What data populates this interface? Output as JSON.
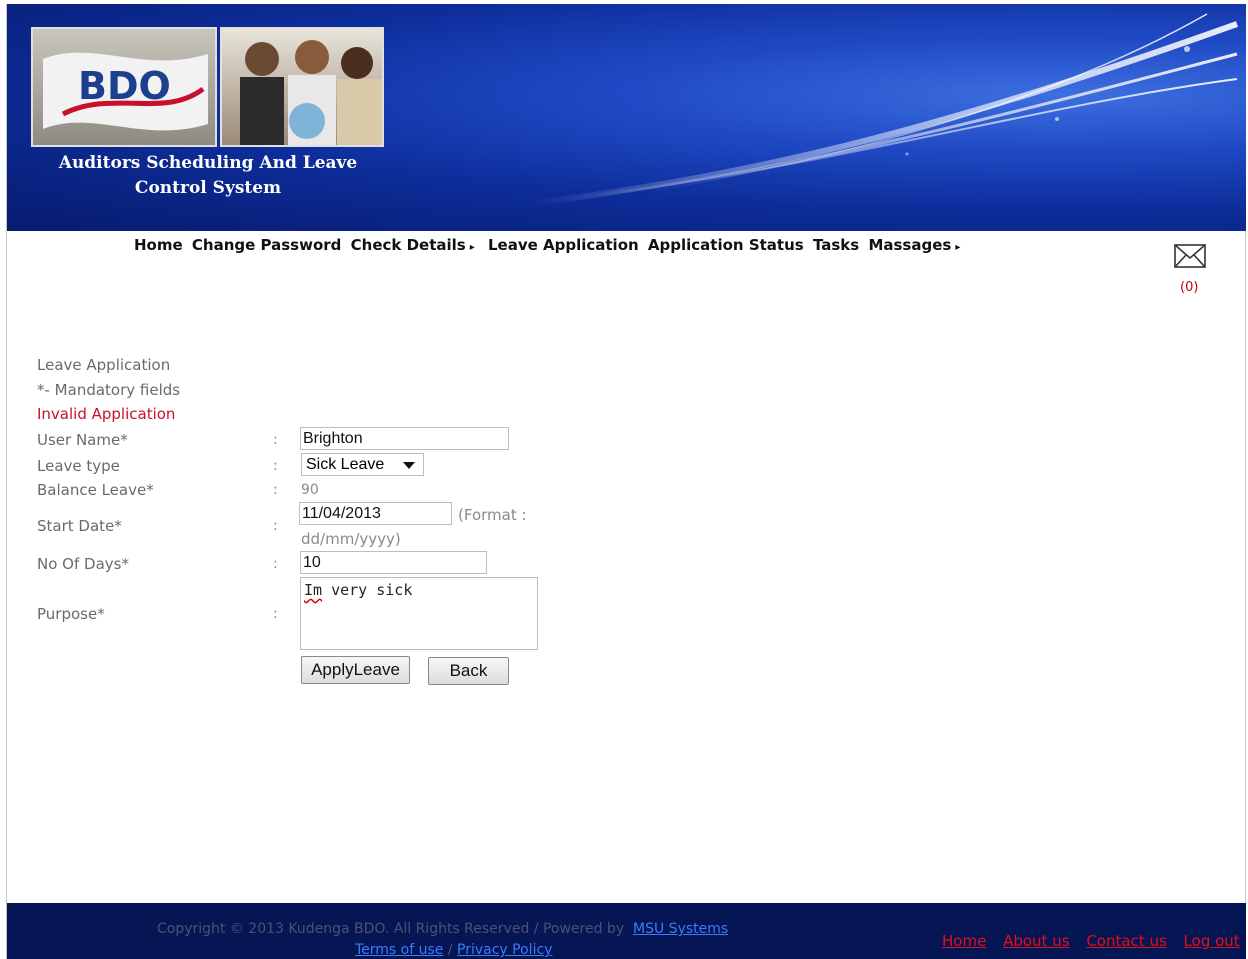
{
  "header": {
    "title": "Auditors Scheduling And Leave Control System",
    "flag_text": "BDO"
  },
  "nav": {
    "items": [
      {
        "label": "Home",
        "has_submenu": false
      },
      {
        "label": "Change Password",
        "has_submenu": false
      },
      {
        "label": "Check Details",
        "has_submenu": true
      },
      {
        "label": "Leave Application",
        "has_submenu": false
      },
      {
        "label": "Application Status",
        "has_submenu": false
      },
      {
        "label": "Tasks",
        "has_submenu": false
      },
      {
        "label": "Massages",
        "has_submenu": true
      }
    ],
    "caret": "▸"
  },
  "messages": {
    "icon": "envelope-icon",
    "count": "(0)"
  },
  "form": {
    "heading": "Leave Application",
    "mandatory_note": "*- Mandatory fields",
    "error": "Invalid Application",
    "colon": ":",
    "user_name_label": "User Name*",
    "user_name_value": "Brighton",
    "leave_type_label": "Leave type",
    "leave_type_value": "Sick Leave",
    "balance_label": "Balance Leave*",
    "balance_value": "90",
    "start_date_label": "Start Date*",
    "start_date_value": "11/04/2013",
    "date_format_hint_1": "(Format :",
    "date_format_hint_2": "dd/mm/yyyy)",
    "days_label": "No Of Days*",
    "days_value": "10",
    "purpose_label": "Purpose*",
    "purpose_word1": "Im",
    "purpose_rest": " very sick",
    "apply_button": "ApplyLeave",
    "back_button": "Back"
  },
  "footer": {
    "copyright": "Copyright © 2013 Kudenga BDO. All Rights Reserved / Powered by",
    "powered_link": "MSU Systems",
    "terms": "Terms of use",
    "sep": " / ",
    "privacy": "Privacy Policy",
    "links": [
      "Home",
      "About us",
      "Contact us",
      "Log out"
    ]
  },
  "colors": {
    "banner": "#0d2d9a",
    "footer": "#061553",
    "error": "#c8102e",
    "footer_link": "#e0101a"
  }
}
